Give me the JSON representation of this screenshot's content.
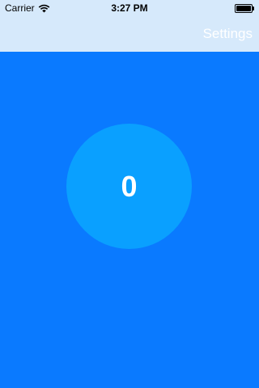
{
  "status_bar": {
    "carrier": "Carrier",
    "time": "3:27 PM",
    "wifi_icon": "wifi-icon",
    "battery_icon": "battery-icon"
  },
  "nav_bar": {
    "settings_label": "Settings"
  },
  "counter": {
    "value": "0"
  },
  "colors": {
    "background": "#0a7aff",
    "nav_bar": "#d6e9fb",
    "circle": "#0aa0ff",
    "text": "#ffffff"
  }
}
